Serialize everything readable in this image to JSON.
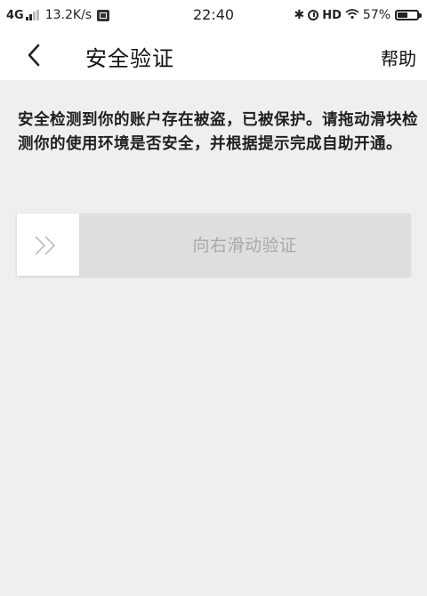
{
  "status_bar": {
    "network": "4G",
    "speed": "13.2K/s",
    "time": "22:40",
    "hd": "HD",
    "battery_percent": "57%",
    "battery_level": 0.57
  },
  "nav": {
    "title": "安全验证",
    "help_label": "帮助"
  },
  "notice": {
    "text": "安全检测到你的账户存在被盗，已被保护。请拖动滑块检测你的使用环境是否安全，并根据提示完成自助开通。"
  },
  "slider": {
    "label": "向右滑动验证"
  }
}
